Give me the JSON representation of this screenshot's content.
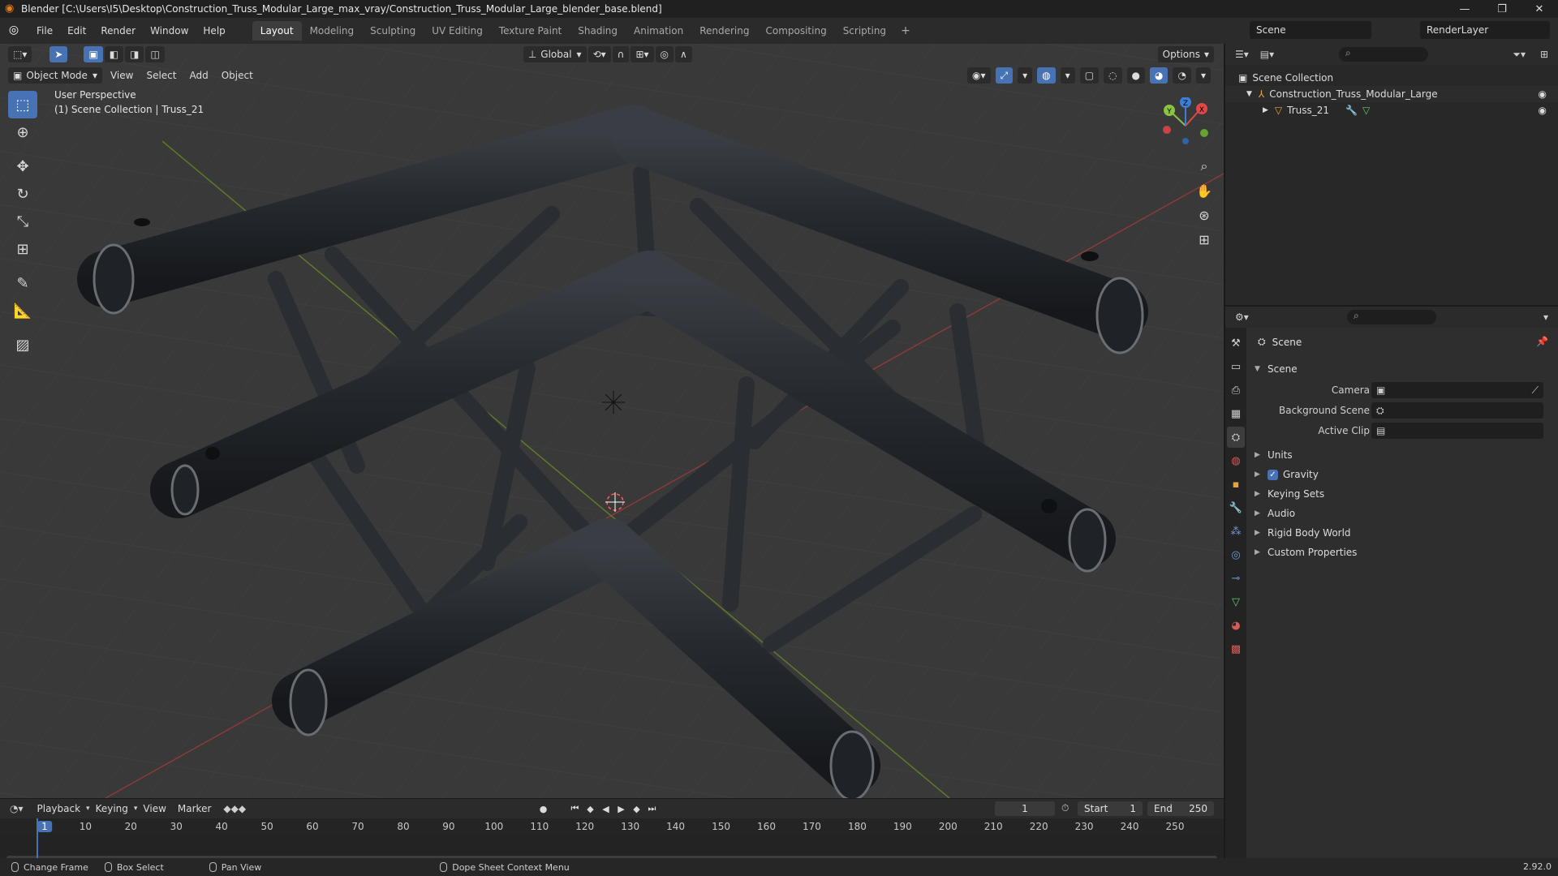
{
  "titlebar": {
    "title": "Blender [C:\\Users\\I5\\Desktop\\Construction_Truss_Modular_Large_max_vray/Construction_Truss_Modular_Large_blender_base.blend]",
    "minimize": "—",
    "maximize": "❐",
    "close": "✕"
  },
  "menu": {
    "file": "File",
    "edit": "Edit",
    "render": "Render",
    "window": "Window",
    "help": "Help"
  },
  "workspaces": [
    "Layout",
    "Modeling",
    "Sculpting",
    "UV Editing",
    "Texture Paint",
    "Shading",
    "Animation",
    "Rendering",
    "Compositing",
    "Scripting"
  ],
  "active_workspace": "Layout",
  "scene_selector": {
    "value": "Scene"
  },
  "renderlayer_selector": {
    "value": "RenderLayer"
  },
  "viewport": {
    "mode": "Object Mode",
    "menus": {
      "view": "View",
      "select": "Select",
      "add": "Add",
      "object": "Object"
    },
    "transform_orientation": "Global",
    "options": "Options",
    "overlay_perspective": "User Perspective",
    "overlay_collection": "(1) Scene Collection | Truss_21",
    "gizmo": {
      "x": "X",
      "y": "Y",
      "z": "Z"
    }
  },
  "outliner": {
    "scene_collection": "Scene Collection",
    "collection": "Construction_Truss_Modular_Large",
    "object": "Truss_21"
  },
  "properties": {
    "breadcrumb": "Scene",
    "panel_title": "Scene",
    "camera_label": "Camera",
    "background_scene_label": "Background Scene",
    "active_clip_label": "Active Clip",
    "sections": [
      "Units",
      "Gravity",
      "Keying Sets",
      "Audio",
      "Rigid Body World",
      "Custom Properties"
    ]
  },
  "timeline": {
    "menus": {
      "playback": "Playback",
      "keying": "Keying",
      "view": "View",
      "marker": "Marker"
    },
    "current_frame": "1",
    "start_label": "Start",
    "start_value": "1",
    "end_label": "End",
    "end_value": "250",
    "ruler_ticks": [
      "1",
      "10",
      "20",
      "30",
      "40",
      "50",
      "60",
      "70",
      "80",
      "90",
      "100",
      "110",
      "120",
      "130",
      "140",
      "150",
      "160",
      "170",
      "180",
      "190",
      "200",
      "210",
      "220",
      "230",
      "240",
      "250"
    ]
  },
  "statusbar": {
    "change_frame": "Change Frame",
    "box_select": "Box Select",
    "pan_view": "Pan View",
    "context_menu": "Dope Sheet Context Menu",
    "version": "2.92.0"
  },
  "colors": {
    "accent": "#4772b3",
    "axis_x": "#e04848",
    "axis_y": "#8ac442",
    "axis_z": "#3b7fd6"
  }
}
